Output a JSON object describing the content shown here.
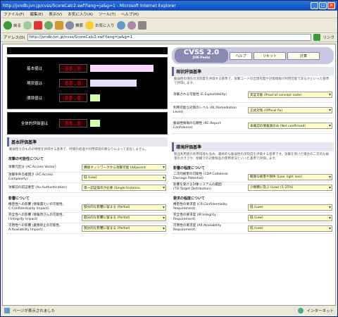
{
  "window": {
    "title": "http://jvndb.jvn.jp/cvss/ScoreCalc2.swf?lang=ja&g=1 - Microsoft Internet Explorer"
  },
  "menu": [
    "ファイル(F)",
    "編集(E)",
    "表示(V)",
    "お気に入り(A)",
    "ツール(T)",
    "ヘルプ(H)"
  ],
  "toolbar": {
    "back": "戻る",
    "search": "検索",
    "favorites": "お気に入り"
  },
  "address": {
    "label": "アドレス(D)",
    "url": "http://jvndb.jvn.jp/cvss/ScoreCalc2.swf?lang=ja&g=1",
    "links": "リンク"
  },
  "scores": [
    {
      "label": "基本値は",
      "digits": "88.8",
      "bar_color": "#f8d8ff",
      "bar_fraction": 0.75
    },
    {
      "label": "現状値は",
      "digits": "88.8",
      "bar_color": "#e8e0ff",
      "bar_fraction": 0.55
    },
    {
      "label": "環境値は",
      "digits": "88.8",
      "bar_color": "#d6ffb0",
      "bar_fraction": 0.12
    },
    {
      "label": "全体的評価値は",
      "digits": "88.8",
      "bar_color": "#d6ffb0",
      "bar_fraction": 0.12
    }
  ],
  "base": {
    "title": "基本評価基準",
    "desc": "脆弱性そのものの特性を評価する基準で、時間の経過や利用環境の異なりによって変化しません。",
    "exploit_title": "攻撃の可能性について",
    "exploit": [
      {
        "label": "攻撃元区分 (AC:Access Vector)",
        "value": "隣接ネットワークから攻撃可能 (Adjacent"
      },
      {
        "label": "攻撃条件の複雑さ (AC:Access Complexity)",
        "value": "低 (Low)"
      },
      {
        "label": "攻撃前の認証要否 (Au:Authentication)",
        "value": "単一認証操作が必要 (Single Instance"
      }
    ],
    "impact_title": "影響について",
    "impact": [
      {
        "label": "機密性への影響 (情報漏えいの可能性、C:Confidentiality Impact)",
        "value": "部分的な影響に留まる (Partial)"
      },
      {
        "label": "完全性への影響 (情報改ざんの可能性、I:Integrity Impact)",
        "value": "部分的な影響に留まる (Partial)"
      },
      {
        "label": "可用性への影響 (業務停止の可能性、A:Availability Impact)",
        "value": "部分的な影響に留まる (Partial)"
      }
    ]
  },
  "header": {
    "logo": "CVSS 2.0",
    "logo_sub": "JVN Pedia",
    "help": "ヘルプ",
    "reset": "リセット",
    "score": "計算"
  },
  "temporal": {
    "title": "現状評価基準",
    "desc": "脆弱性の現在の深刻度を評価する基準で、攻撃コードの出現有無や対策情報が利用可能であるかといった基準で評価します。",
    "items": [
      {
        "label": "攻撃される可能性 (E:Exploitability)",
        "value": "実証可能 (Proof of concept code)"
      },
      {
        "label": "利用可能な対策のレベル (RL:Remediation Level)",
        "value": "正式対策 (Official fix)"
      },
      {
        "label": "脆弱性情報の信頼性 (RC:Report Confidence)",
        "value": "未確認の情報源のみ (Not confirmed)"
      }
    ]
  },
  "env": {
    "title": "環境評価基準",
    "desc": "製品利用者の利用環境も含め、最終的な脆弱性の深刻度を評価する基準です。攻撃を受けた場合の二次的な被害の大きさや、組織での対象製品の使用状況といった基準で評価します。",
    "impact_title": "影響の程度について",
    "impact": [
      {
        "label": "二次的被害の可能性 (CDP:Collateral Damage Potential)",
        "value": "軽微な被害や損失 (Low: light loss)"
      },
      {
        "label": "影響を受ける対象システムの範囲 (TD:Target Distribution)",
        "value": "小規模に及ぶ (Low) (1-25%)"
      }
    ],
    "req_title": "要求の程度について",
    "req": [
      {
        "label": "機密性の要求度 (CR:Confidentiality Requirement)",
        "value": "低 (Low)"
      },
      {
        "label": "完全性の要求度 (IR:Integrity Requirement)",
        "value": "低 (Low)"
      },
      {
        "label": "可用性の要求度 (AR:Availability Requirement)",
        "value": "低 (Low)"
      }
    ]
  },
  "status": {
    "text": "ページが表示されました",
    "zone": "インターネット"
  }
}
